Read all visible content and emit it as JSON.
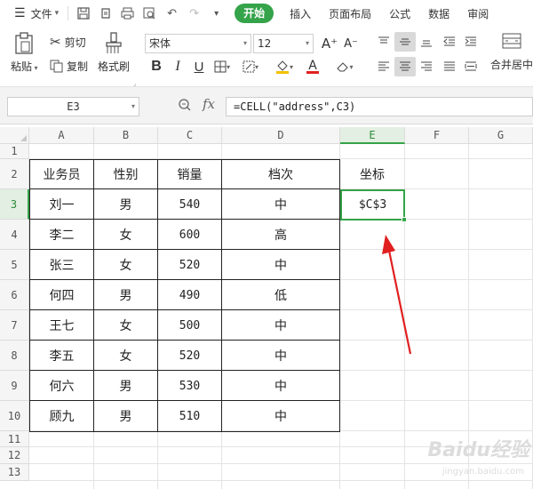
{
  "menubar": {
    "file_label": "文件",
    "tabs": [
      "开始",
      "插入",
      "页面布局",
      "公式",
      "数据",
      "审阅"
    ],
    "active_tab": "开始"
  },
  "ribbon": {
    "paste_label": "粘贴",
    "cut_label": "剪切",
    "copy_label": "复制",
    "format_painter_label": "格式刷",
    "font_name": "宋体",
    "font_size": "12",
    "merge_label": "合并居中",
    "bold": "B",
    "italic": "I",
    "underline": "U",
    "font_color_letter": "A",
    "grow_font": "A⁺",
    "shrink_font": "A⁻"
  },
  "formulabar": {
    "name_box": "E3",
    "fx": "fx",
    "formula": "=CELL(\"address\",C3)"
  },
  "sheet": {
    "columns": [
      "A",
      "B",
      "C",
      "D",
      "E",
      "F",
      "G"
    ],
    "active_column": "E",
    "rows": [
      "1",
      "2",
      "3",
      "4",
      "5",
      "6",
      "7",
      "8",
      "9",
      "10",
      "11",
      "12",
      "13"
    ],
    "active_row": "3",
    "table": {
      "headers": [
        "业务员",
        "性别",
        "销量",
        "档次"
      ],
      "rows": [
        [
          "刘一",
          "男",
          "540",
          "中"
        ],
        [
          "李二",
          "女",
          "600",
          "高"
        ],
        [
          "张三",
          "女",
          "520",
          "中"
        ],
        [
          "何四",
          "男",
          "490",
          "低"
        ],
        [
          "王七",
          "女",
          "500",
          "中"
        ],
        [
          "李五",
          "女",
          "520",
          "中"
        ],
        [
          "何六",
          "男",
          "530",
          "中"
        ],
        [
          "顾九",
          "男",
          "510",
          "中"
        ]
      ]
    },
    "e_header": "坐标",
    "e3_value": "$C$3"
  },
  "watermark": {
    "main": "Baidu经验",
    "sub": "jingyan.baidu.com"
  },
  "colors": {
    "accent": "#35a349",
    "arrow": "#e02020"
  }
}
